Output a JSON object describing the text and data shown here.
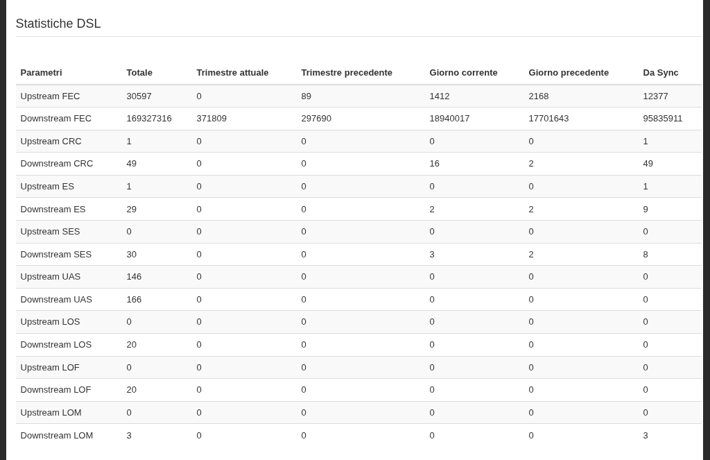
{
  "title": "Statistiche DSL",
  "table": {
    "columns": [
      "Parametri",
      "Totale",
      "Trimestre attuale",
      "Trimestre precedente",
      "Giorno corrente",
      "Giorno precedente",
      "Da Sync"
    ],
    "rows": [
      [
        "Upstream FEC",
        "30597",
        "0",
        "89",
        "1412",
        "2168",
        "12377"
      ],
      [
        "Downstream FEC",
        "169327316",
        "371809",
        "297690",
        "18940017",
        "17701643",
        "95835911"
      ],
      [
        "Upstream CRC",
        "1",
        "0",
        "0",
        "0",
        "0",
        "1"
      ],
      [
        "Downstream CRC",
        "49",
        "0",
        "0",
        "16",
        "2",
        "49"
      ],
      [
        "Upstream ES",
        "1",
        "0",
        "0",
        "0",
        "0",
        "1"
      ],
      [
        "Downstream ES",
        "29",
        "0",
        "0",
        "2",
        "2",
        "9"
      ],
      [
        "Upstream SES",
        "0",
        "0",
        "0",
        "0",
        "0",
        "0"
      ],
      [
        "Downstream SES",
        "30",
        "0",
        "0",
        "3",
        "2",
        "8"
      ],
      [
        "Upstream UAS",
        "146",
        "0",
        "0",
        "0",
        "0",
        "0"
      ],
      [
        "Downstream UAS",
        "166",
        "0",
        "0",
        "0",
        "0",
        "0"
      ],
      [
        "Upstream LOS",
        "0",
        "0",
        "0",
        "0",
        "0",
        "0"
      ],
      [
        "Downstream LOS",
        "20",
        "0",
        "0",
        "0",
        "0",
        "0"
      ],
      [
        "Upstream LOF",
        "0",
        "0",
        "0",
        "0",
        "0",
        "0"
      ],
      [
        "Downstream LOF",
        "20",
        "0",
        "0",
        "0",
        "0",
        "0"
      ],
      [
        "Upstream LOM",
        "0",
        "0",
        "0",
        "0",
        "0",
        "0"
      ],
      [
        "Downstream LOM",
        "3",
        "0",
        "0",
        "0",
        "0",
        "3"
      ]
    ]
  }
}
